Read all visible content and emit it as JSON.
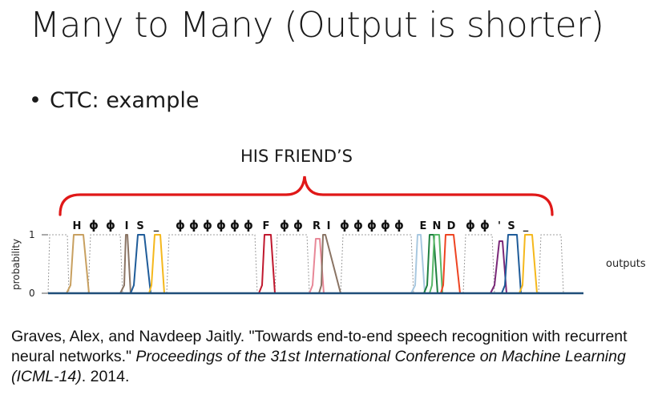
{
  "slide": {
    "title": "Many to Many (Output is shorter)",
    "bullet": "CTC: example",
    "transcript": "HIS FRIEND’S"
  },
  "figure": {
    "symbol_labels": [
      "H",
      "ϕ",
      "ϕ",
      "I",
      "S",
      "_",
      "ϕ",
      "ϕ",
      "ϕ",
      "ϕ",
      "ϕ",
      "ϕ",
      "F",
      "ϕ",
      "ϕ",
      "R",
      "I",
      "ϕ",
      "ϕ",
      "ϕ",
      "ϕ",
      "ϕ",
      "E",
      "N",
      "D",
      "ϕ",
      "ϕ",
      "'",
      "S",
      "_"
    ],
    "y_axis_label": "probability",
    "y_tick_top": "1",
    "y_tick_bottom": "0",
    "outputs_label": "outputs",
    "colors": {
      "brace": "#e01818",
      "baseline": "#1f4e79",
      "blank": "#9e9e9e"
    }
  },
  "citation": {
    "authors": "Graves, Alex, and Navdeep Jaitly. ",
    "title": "\"Towards end-to-end speech recognition with recurrent neural networks.\" ",
    "venue": "Proceedings of the 31st International Conference on Machine Learning (ICML-14)",
    "year": ". 2014."
  }
}
